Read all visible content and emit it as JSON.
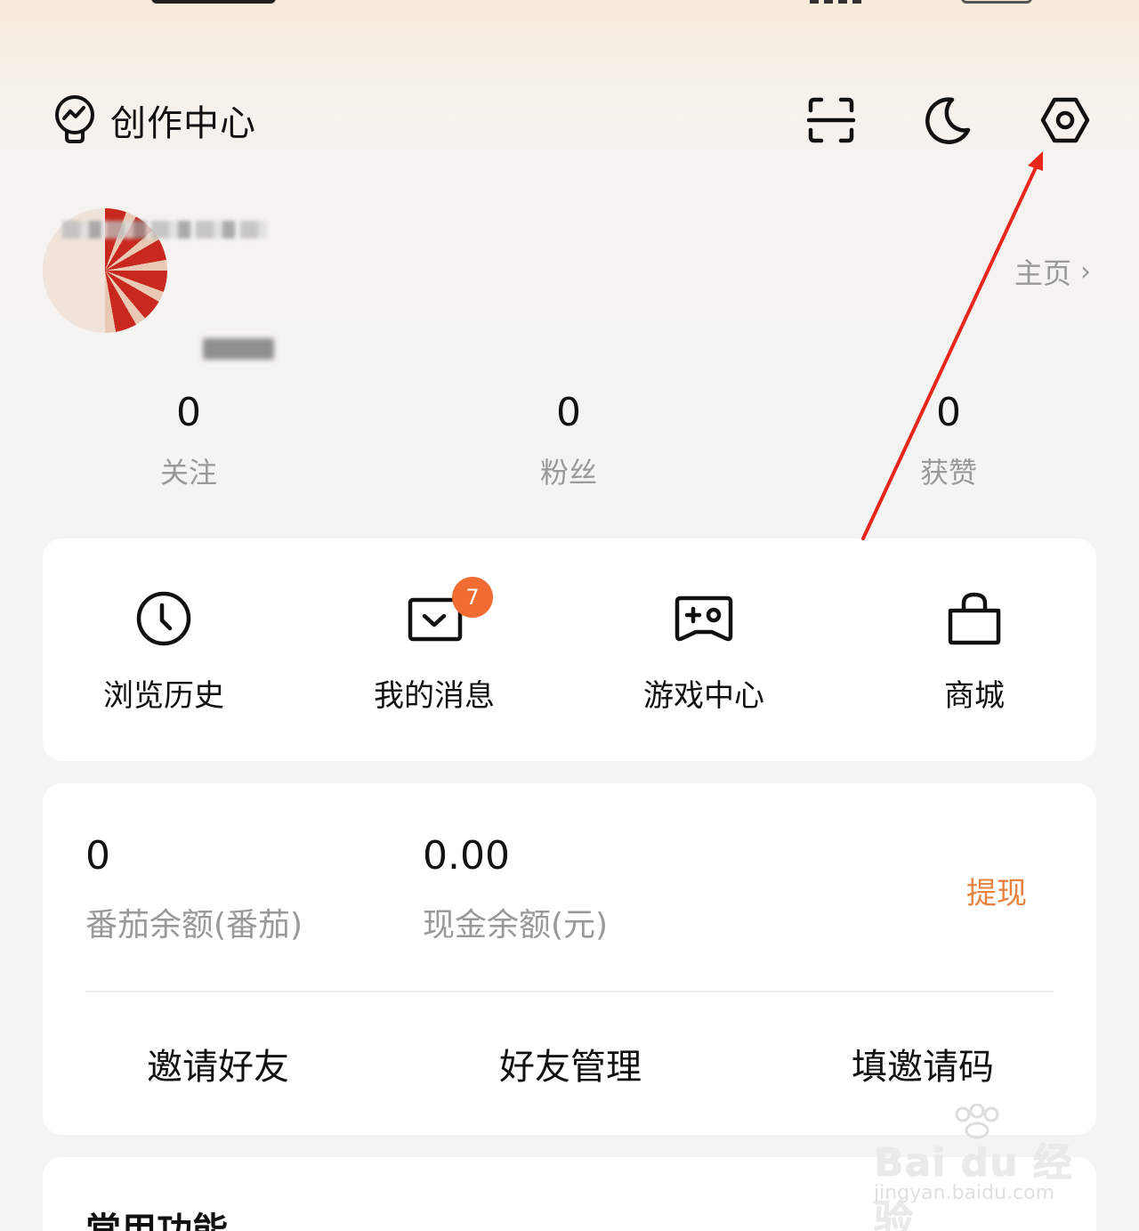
{
  "header": {
    "creator_label": "创作中心",
    "icons": [
      "lightbulb-chart-icon",
      "scan-icon",
      "moon-icon",
      "settings-icon"
    ]
  },
  "profile": {
    "homepage_label": "主页",
    "homepage_chevron": "›"
  },
  "stats": [
    {
      "value": "0",
      "label": "关注"
    },
    {
      "value": "0",
      "label": "粉丝"
    },
    {
      "value": "0",
      "label": "获赞"
    }
  ],
  "quick_actions": [
    {
      "label": "浏览历史",
      "icon": "clock-icon"
    },
    {
      "label": "我的消息",
      "icon": "mail-icon",
      "badge": "7"
    },
    {
      "label": "游戏中心",
      "icon": "gamepad-icon"
    },
    {
      "label": "商城",
      "icon": "shopping-bag-icon"
    }
  ],
  "wallet": {
    "tomato_value": "0",
    "tomato_label": "番茄余额(番茄)",
    "cash_value": "0.00",
    "cash_label": "现金余额(元)",
    "withdraw_label": "提现",
    "withdraw_color": "#e8823f"
  },
  "friends": [
    {
      "label": "邀请好友"
    },
    {
      "label": "好友管理"
    },
    {
      "label": "填邀请码"
    }
  ],
  "common": {
    "title": "常用功能"
  },
  "watermark": {
    "main": "Bai du 经验",
    "sub": "jingyan.baidu.com"
  },
  "colors": {
    "badge": "#f06c33",
    "annotation_arrow": "#e8261c"
  }
}
